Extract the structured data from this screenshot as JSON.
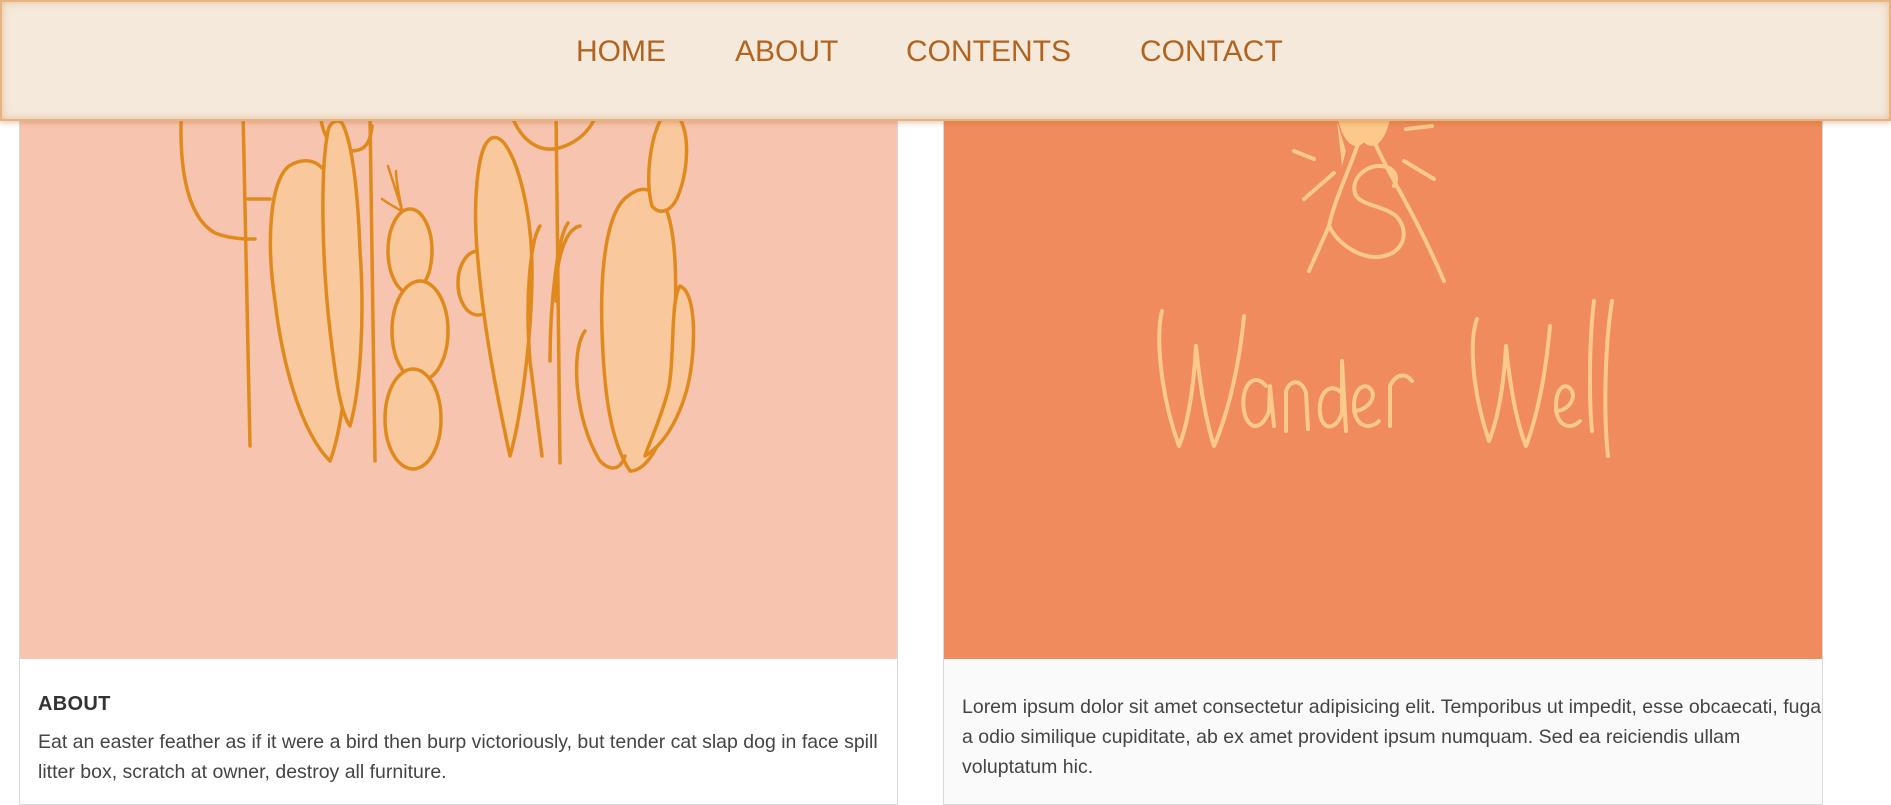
{
  "nav": {
    "items": [
      {
        "label": "HOME"
      },
      {
        "label": "ABOUT"
      },
      {
        "label": "CONTENTS"
      },
      {
        "label": "CONTACT"
      }
    ]
  },
  "cards": [
    {
      "image": "cactus-illustration",
      "title": "ABOUT",
      "text": "Eat an easter feather as if it were a bird then burp victoriously, but tender cat slap dog in face spill litter box, scratch at owner, destroy all furniture."
    },
    {
      "image": "wander-well-logo",
      "logo_text": "Wander Well",
      "text": "Lorem ipsum dolor sit amet consectetur adipisicing elit. Temporibus ut impedit, esse obcaecati, fuga a odio similique cupiditate, ab ex amet provident ipsum numquam. Sed ea reiciendis ullam voluptatum hic."
    }
  ],
  "colors": {
    "nav_bg": "#f5e9dc",
    "nav_text": "#b2641e",
    "cactus_bg": "#f7c4af",
    "cactus_stroke": "#e08a1e",
    "cactus_fill": "#f9c89c",
    "logo_bg": "#ef8b5c",
    "logo_fg": "#fcc98a"
  }
}
